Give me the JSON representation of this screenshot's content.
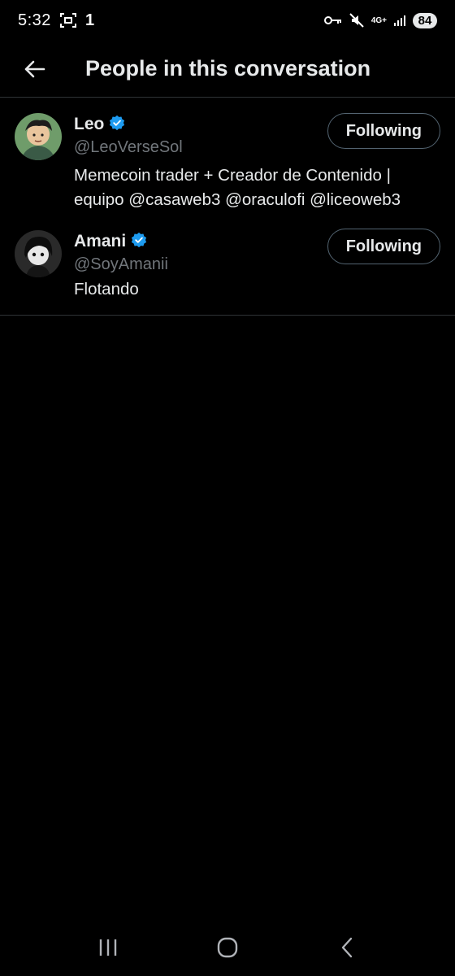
{
  "status_bar": {
    "time": "5:32",
    "notification_count": "1",
    "network": "4G+",
    "battery": "84",
    "icons": [
      "screenshot-icon",
      "key-icon",
      "mute-icon",
      "signal-icon"
    ]
  },
  "header": {
    "title": "People in this conversation",
    "back_icon": "arrow-left-icon"
  },
  "people": [
    {
      "name": "Leo",
      "handle": "@LeoVerseSol",
      "verified": true,
      "bio": "Memecoin trader + Creador de Contenido | equipo @casaweb3 @oraculofi @liceoweb3",
      "follow_label": "Following"
    },
    {
      "name": "Amani",
      "handle": "@SoyAmanii",
      "verified": true,
      "bio": "Flotando",
      "follow_label": "Following"
    }
  ],
  "nav_bar": {
    "icons": [
      "recent-apps-icon",
      "home-icon",
      "back-icon"
    ]
  },
  "colors": {
    "background": "#000000",
    "text": "#e7e9ea",
    "secondary_text": "#71767b",
    "verified_badge": "#1d9bf0",
    "divider": "#2f3336"
  }
}
